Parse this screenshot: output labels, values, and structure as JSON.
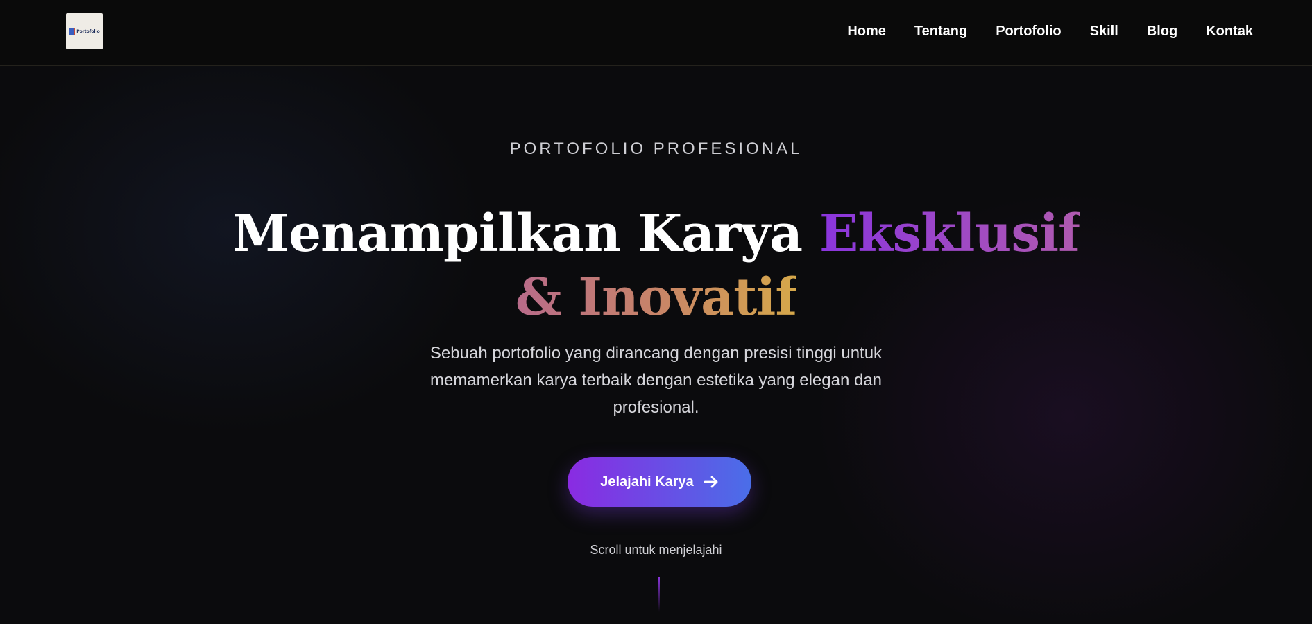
{
  "logo": {
    "text": "Portofolio"
  },
  "nav": {
    "items": [
      {
        "label": "Home"
      },
      {
        "label": "Tentang"
      },
      {
        "label": "Portofolio"
      },
      {
        "label": "Skill"
      },
      {
        "label": "Blog"
      },
      {
        "label": "Kontak"
      }
    ]
  },
  "hero": {
    "eyebrow": "PORTOFOLIO PROFESIONAL",
    "headline_plain": "Menampilkan Karya ",
    "headline_accent1": "Eksklusif",
    "headline_accent2": "& Inovatif",
    "subtitle": "Sebuah portofolio yang dirancang dengan presisi tinggi untuk memamerkan karya terbaik dengan estetika yang elegan dan profesional.",
    "cta_label": "Jelajahi Karya",
    "cta_icon": "arrow-right-icon",
    "scroll_hint": "Scroll untuk menjelajahi"
  },
  "colors": {
    "background": "#0b0b0d",
    "accent_purple": "#8a2be2",
    "accent_blue": "#4a6ee8",
    "accent_gold": "#d6a84a"
  }
}
